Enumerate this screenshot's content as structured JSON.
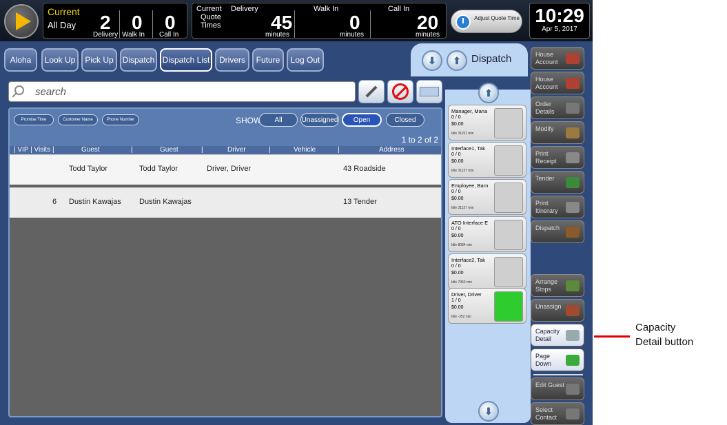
{
  "header": {
    "current_label": "Current",
    "period": "All Day",
    "counts": [
      {
        "value": "2",
        "label": "Delivery"
      },
      {
        "value": "0",
        "label": "Walk In"
      },
      {
        "value": "0",
        "label": "Call In"
      }
    ],
    "quote_title_1": "Current",
    "quote_title_2": "Quote",
    "quote_title_3": "Times",
    "quotes": [
      {
        "label": "Delivery",
        "value": "45",
        "unit": "minutes"
      },
      {
        "label": "Walk In",
        "value": "0",
        "unit": "minutes"
      },
      {
        "label": "Call In",
        "value": "20",
        "unit": "minutes"
      }
    ],
    "adjust_label": "Adjust Quote Time",
    "time": "10:29",
    "date": "Apr 5, 2017"
  },
  "nav_tabs": [
    "Aloha",
    "Look Up",
    "Pick Up",
    "Dispatch",
    "Dispatch List",
    "Drivers",
    "Future",
    "Log Out"
  ],
  "dispatch_tab": {
    "title": "Dispatch"
  },
  "search": {
    "placeholder": "search"
  },
  "filters": {
    "sort_buttons": [
      "Promise Time",
      "Customer Name",
      "Phone Number"
    ],
    "show_label": "SHOW:",
    "show_options": [
      "All",
      "Unassigned",
      "Open",
      "Closed"
    ],
    "selected": "Open",
    "count_text": "1 to 2 of 2"
  },
  "columns": [
    "| VIP | Visits |",
    "Guest",
    "|",
    "Guest",
    "|",
    "Driver",
    "|",
    "Vehicle",
    "|",
    "Address"
  ],
  "rows": [
    {
      "visits": "",
      "guest1": "Todd Taylor",
      "guest2": "Todd Taylor",
      "driver": "Driver, Driver",
      "address": "43 Roadside"
    },
    {
      "visits": "6",
      "guest1": "Dustin Kawajas",
      "guest2": "Dustin Kawajas",
      "driver": "",
      "address": "13 Tender"
    }
  ],
  "drivers": [
    {
      "name": "Manager, Mana",
      "orders": "0 / 0",
      "amount": "$0.00",
      "idle": "Idle 31151 min",
      "status": "idle"
    },
    {
      "name": "Interface1, Tak",
      "orders": "0 / 0",
      "amount": "$0.00",
      "idle": "Idle 31137 min",
      "status": "idle"
    },
    {
      "name": "Employee, Barn",
      "orders": "0 / 0",
      "amount": "$0.00",
      "idle": "Idle 31137 min",
      "status": "idle"
    },
    {
      "name": "ATO Interface E",
      "orders": "0 / 0",
      "amount": "$0.00",
      "idle": "Idle 8084 min",
      "status": "idle"
    },
    {
      "name": "Interface2, Tak",
      "orders": "0 / 0",
      "amount": "$0.00",
      "idle": "Idle 7953 min",
      "status": "idle"
    },
    {
      "name": "Driver, Driver",
      "orders": "1 / 0",
      "amount": "$0.00",
      "idle": "Idle -352 min",
      "status": "active"
    }
  ],
  "side_buttons": [
    {
      "label": "House Account",
      "icon": "truck-icon",
      "style": "dark"
    },
    {
      "label": "House Account",
      "icon": "truck-plus-icon",
      "style": "dark"
    },
    {
      "label": "Order Details",
      "icon": "magnifier-icon",
      "style": "dark"
    },
    {
      "label": "Modify",
      "icon": "pencil-icon",
      "style": "dark"
    },
    {
      "label": "Print Receipt",
      "icon": "printer-icon",
      "style": "dark"
    },
    {
      "label": "Tender",
      "icon": "cash-register-icon",
      "style": "dark"
    },
    {
      "label": "Print Itinerary",
      "icon": "printer-route-icon",
      "style": "dark"
    },
    {
      "label": "Dispatch",
      "icon": "dispatch-icon",
      "style": "dark"
    },
    {
      "label": "Arrange Stops",
      "icon": "tree-icon",
      "style": "dark"
    },
    {
      "label": "Unassign",
      "icon": "person-icon",
      "style": "dark"
    },
    {
      "label": "Capacity Detail",
      "icon": "wand-icon",
      "style": "light"
    },
    {
      "label": "Page Down",
      "icon": "arrow-down-icon",
      "style": "light"
    },
    {
      "label": "Edit Guest",
      "icon": "tools-icon",
      "style": "dark"
    },
    {
      "label": "Select Contact",
      "icon": "contact-icon",
      "style": "dark"
    }
  ],
  "annotation": {
    "line1": "Capacity",
    "line2": "Detail button",
    "color": "#e00000"
  }
}
